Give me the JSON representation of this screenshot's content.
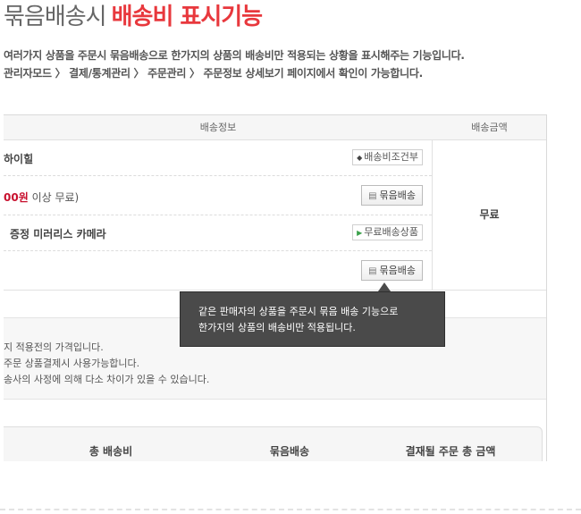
{
  "title": {
    "light": "묶음배송시",
    "accent": "배송비 표시기능"
  },
  "description": [
    "여러가지 상품을 주문시 묶음배송으로 한가지의 상품의 배송비만 적용되는 상황을 표시해주는 기능입니다.",
    "관리자모드 〉 결제/통계관리 〉 주문관리 〉 주문정보 상세보기 페이지에서 확인이 가능합니다."
  ],
  "table": {
    "headers": {
      "info": "배송정보",
      "fee": "배송금액"
    },
    "rows": {
      "product1": "하이힐",
      "tag1": "배송비조건부",
      "condition_amount": "00원",
      "condition_rest": " 이상 무료)",
      "button1": "묶음배송",
      "product2": "증정 미러리스 카메라",
      "tag2": "무료배송상품",
      "button2": "묶음배송"
    },
    "fee_value": "무료"
  },
  "notes": [
    "지 적용전의 가격입니다.",
    "주문 상품결제시 사용가능합니다.",
    "송사의 사정에 의해 다소 차이가 있을 수 있습니다."
  ],
  "summary": {
    "total_shipping": "총 배송비",
    "bundle": "묶음배송",
    "total_order": "결재될 주문 총 금액"
  },
  "tooltip": [
    "같은 판매자의 상품을 주문시 묶음 배송 기능으로",
    "한가지의 상품의 배송비만 적용됩니다."
  ],
  "icons": {
    "tag1": "diamond-bullet-icon",
    "tag2": "green-arrow-icon",
    "button": "box-icon"
  },
  "colors": {
    "accent": "#e8383d",
    "price": "#c8102e",
    "tooltip_bg": "#4a4a4a"
  }
}
